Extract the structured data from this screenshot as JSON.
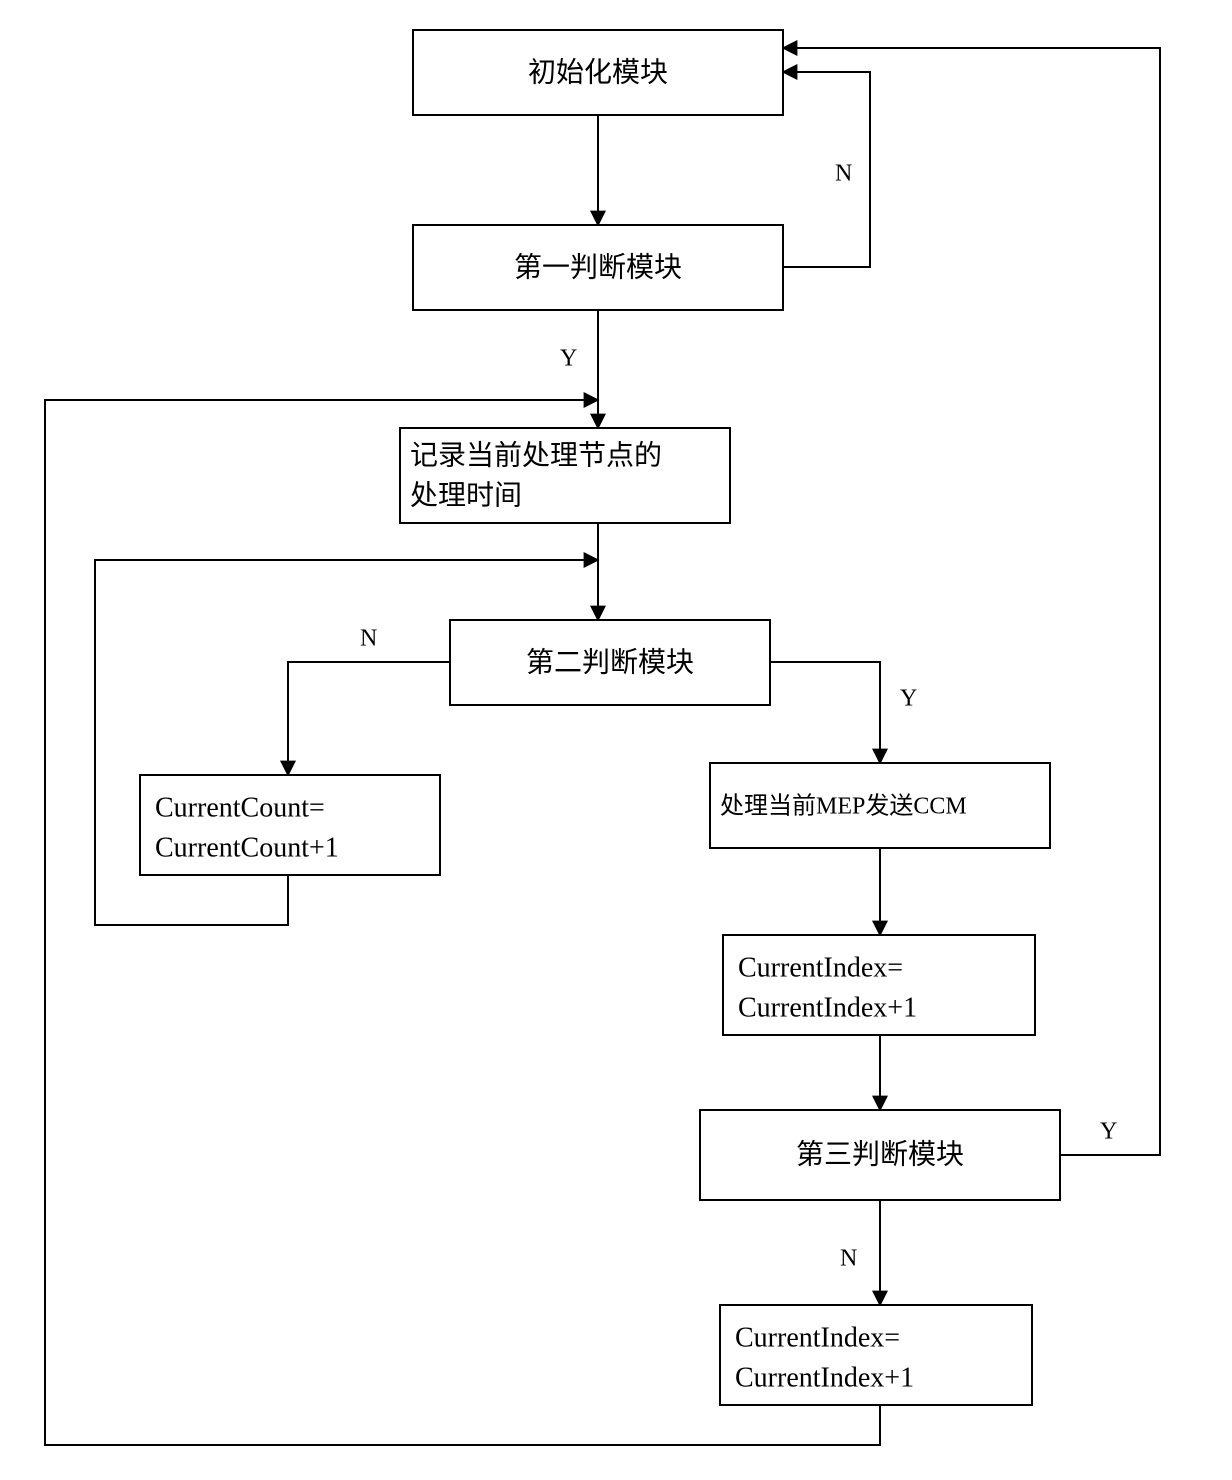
{
  "nodes": {
    "init": {
      "text": "初始化模块"
    },
    "judge1": {
      "text": "第一判断模块"
    },
    "record": {
      "line1": "记录当前处理节点的",
      "line2": "处理时间"
    },
    "judge2": {
      "text": "第二判断模块"
    },
    "countInc": {
      "line1": "CurrentCount=",
      "line2": "CurrentCount+1"
    },
    "mepSend": {
      "text": "处理当前MEP发送CCM"
    },
    "indexInc1": {
      "line1": "CurrentIndex=",
      "line2": "CurrentIndex+1"
    },
    "judge3": {
      "text": "第三判断模块"
    },
    "indexInc2": {
      "line1": "CurrentIndex=",
      "line2": "CurrentIndex+1"
    }
  },
  "edgeLabels": {
    "yes": "Y",
    "no": "N"
  }
}
